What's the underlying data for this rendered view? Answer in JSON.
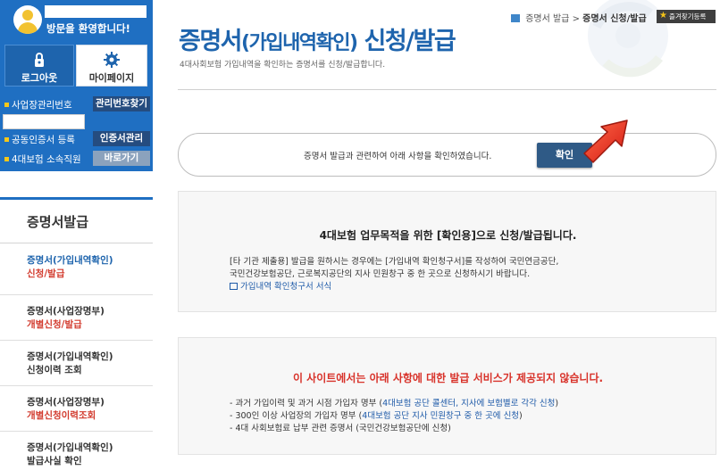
{
  "user_panel": {
    "welcome": "방문을 환영합니다!",
    "logout_label": "로그아웃",
    "mypage_label": "마이페이지",
    "biz_number_label": "사업장관리번호",
    "find_button": "관리번호찾기",
    "cert_register_label": "공동인증서 등록",
    "cert_manage_button": "인증서관리",
    "staff_label": "4대보험 소속직원",
    "goto_button": "바로가기"
  },
  "left_menu": {
    "title": "증명서발급",
    "items": [
      {
        "line1": "증명서(가입내역확인)",
        "line2": "신청/발급"
      },
      {
        "line1": "증명서(사업장명부)",
        "line2": "개별신청/발급"
      },
      {
        "line1": "증명서(가입내역확인)",
        "line2": "신청이력 조회"
      },
      {
        "line1": "증명서(사업장명부)",
        "line2": "개별신청이력조회"
      },
      {
        "line1": "증명서(가입내역확인)",
        "line2": "발급사실 확인"
      }
    ]
  },
  "header": {
    "title_a": "증명서",
    "title_b": "(가입내역확인)",
    "title_c": " 신청/발급",
    "subtitle": "4대사회보험 가입내역을 확인하는 증명서를 신청/발급합니다.",
    "breadcrumb_parent": "증명서 발급",
    "breadcrumb_sep": ">",
    "breadcrumb_current": "증명서 신청/발급",
    "favorites": "즐겨찾기등록"
  },
  "confirm": {
    "text": "증명서 발급과 관련하여 아래 사항을 확인하였습니다.",
    "button": "확인"
  },
  "notice1": {
    "heading": "4대보험 업무목적을 위한 [확인용]으로 신청/발급됩니다.",
    "line1": "[타 기관 제출용] 발급을 원하시는 경우에는 [가입내역 확인청구서]를 작성하여 국민연금공단,",
    "line2": "국민건강보험공단, 근로복지공단의 지사 민원창구 중 한 곳으로 신청하시기 바랍니다.",
    "link": "가입내역 확인청구서 서식"
  },
  "notice2": {
    "heading": "이 사이트에서는 아래 사항에 대한 발급 서비스가 제공되지 않습니다.",
    "item1_text": "- 과거 가입이력 및 과거 시점 가입자 명부 (",
    "item1_blue": "4대보험 공단 콜센터, 지사에 보험별로 각각 신청",
    "item1_end": ")",
    "item2_text": "- 300인 이상 사업장의 가입자 명부 (",
    "item2_blue": "4대보험 공단 지사 민원창구 중 한 곳에 신청",
    "item2_end": ")",
    "item3": "- 4대 사회보험료 납부 관련 증명서 (국민건강보험공단에 신청)"
  },
  "colors": {
    "primary_blue": "#1f6fc2",
    "accent_red": "#d8322a",
    "confirm_button": "#2f5a86"
  }
}
